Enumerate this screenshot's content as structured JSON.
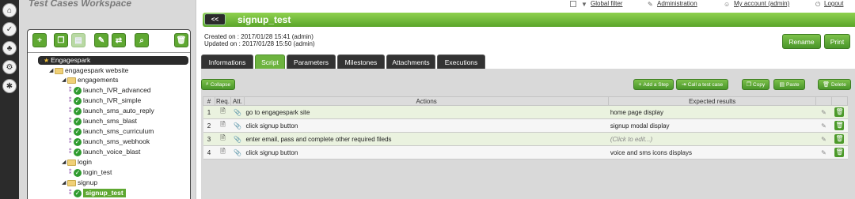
{
  "workspace": {
    "title": "Test Cases Workspace",
    "tree": {
      "root": "Engagespark",
      "project": "engagespark website",
      "folders": [
        {
          "name": "engagements",
          "items": [
            "launch_IVR_advanced",
            "launch_IVR_simple",
            "launch_sms_auto_reply",
            "launch_sms_blast",
            "launch_sms_curriculum",
            "launch_sms_webhook",
            "launch_voice_blast"
          ]
        },
        {
          "name": "login",
          "items": [
            "login_test"
          ]
        },
        {
          "name": "signup",
          "items": [
            "signup_test"
          ]
        }
      ]
    }
  },
  "nav": {
    "global_filter": "Global filter",
    "administration": "Administration",
    "my_account": "My account (admin)",
    "logout": "Logout"
  },
  "header": {
    "back_label": "<<",
    "title": "signup_test"
  },
  "meta": {
    "created_label": "Created on :",
    "created_value": "2017/01/28 15:41 (admin)",
    "updated_label": "Updated on :",
    "updated_value": "2017/01/28 15:50 (admin)"
  },
  "actions": {
    "rename": "Rename",
    "print": "Print"
  },
  "tabs": [
    "Informations",
    "Script",
    "Parameters",
    "Milestones",
    "Attachments",
    "Executions"
  ],
  "script_toolbar": {
    "collapse": "Collapse",
    "add_step": "Add a Step",
    "call_test_case": "Call a test case",
    "copy": "Copy",
    "paste": "Paste",
    "delete": "Delete"
  },
  "steps_table": {
    "headers": [
      "#",
      "Req.",
      "Att.",
      "Actions",
      "Expected results"
    ],
    "rows": [
      {
        "num": "1",
        "action": "go to engagespark site",
        "expected": "home page display"
      },
      {
        "num": "2",
        "action": "click signup button",
        "expected": "signup modal display"
      },
      {
        "num": "3",
        "action": "enter email, pass and complete other required fileds",
        "expected": "(Click to edit...)"
      },
      {
        "num": "4",
        "action": "click signup button",
        "expected": "voice and sms icons displays"
      }
    ]
  },
  "colors": {
    "accent_green": "#5fa832",
    "dark": "#2b2b2b",
    "panel_grey": "#d9d9d9"
  }
}
